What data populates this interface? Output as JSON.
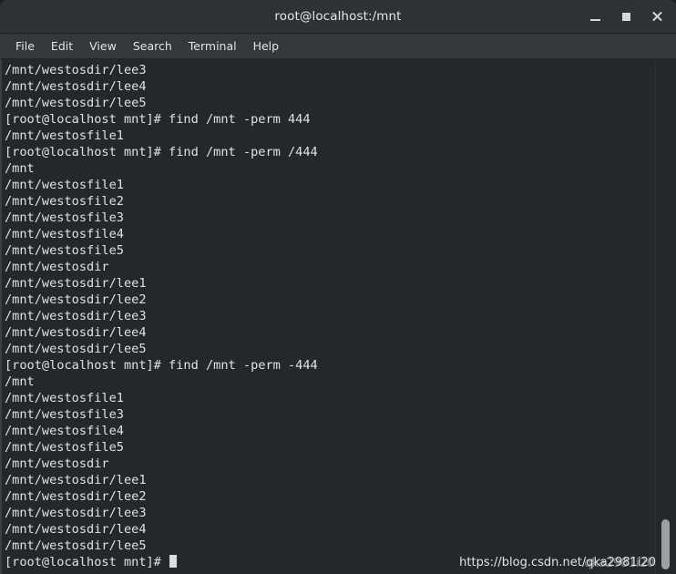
{
  "window": {
    "title": "root@localhost:/mnt",
    "controls": {
      "minimize_label": "_",
      "maximize_label": "□",
      "close_label": "✕"
    }
  },
  "menubar": {
    "items": [
      {
        "label": "File"
      },
      {
        "label": "Edit"
      },
      {
        "label": "View"
      },
      {
        "label": "Search"
      },
      {
        "label": "Terminal"
      },
      {
        "label": "Help"
      }
    ]
  },
  "terminal": {
    "prompt": "[root@localhost mnt]#",
    "lines": [
      "/mnt/westosdir/lee3",
      "/mnt/westosdir/lee4",
      "/mnt/westosdir/lee5",
      "[root@localhost mnt]# find /mnt -perm 444",
      "/mnt/westosfile1",
      "[root@localhost mnt]# find /mnt -perm /444",
      "/mnt",
      "/mnt/westosfile1",
      "/mnt/westosfile2",
      "/mnt/westosfile3",
      "/mnt/westosfile4",
      "/mnt/westosfile5",
      "/mnt/westosdir",
      "/mnt/westosdir/lee1",
      "/mnt/westosdir/lee2",
      "/mnt/westosdir/lee3",
      "/mnt/westosdir/lee4",
      "/mnt/westosdir/lee5",
      "[root@localhost mnt]# find /mnt -perm -444",
      "/mnt",
      "/mnt/westosfile1",
      "/mnt/westosfile3",
      "/mnt/westosfile4",
      "/mnt/westosfile5",
      "/mnt/westosdir",
      "/mnt/westosdir/lee1",
      "/mnt/westosdir/lee2",
      "/mnt/westosdir/lee3",
      "/mnt/westosdir/lee4",
      "/mnt/westosdir/lee5"
    ],
    "current_prompt": "[root@localhost mnt]# "
  },
  "watermark": {
    "primary": "https://blog.csdn.net/qka2981i20",
    "secondary": "qka2981i20"
  },
  "colors": {
    "titlebar_bg": "#2e3236",
    "menubar_bg": "#33383c",
    "terminal_bg": "#25282b",
    "terminal_fg": "#dfe2e4",
    "scrollbar_thumb": "#9ba0a4"
  }
}
